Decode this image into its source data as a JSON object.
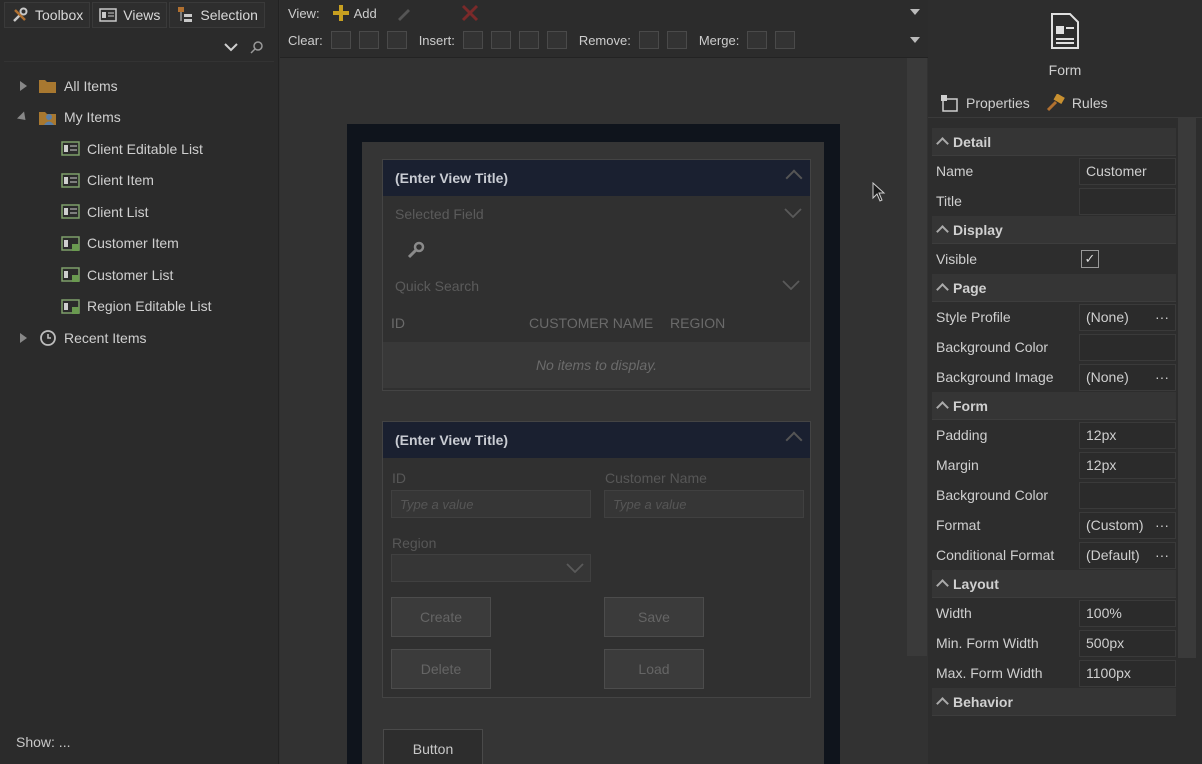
{
  "left_panel": {
    "tabs": [
      {
        "label": "Toolbox",
        "icon": "tools-icon"
      },
      {
        "label": "Views",
        "icon": "views-icon"
      },
      {
        "label": "Selection",
        "icon": "selection-icon"
      }
    ],
    "tree": [
      {
        "label": "All Items",
        "level": 0,
        "expander": "collapsed",
        "icon": "folder-icon"
      },
      {
        "label": "My Items",
        "level": 0,
        "expander": "expanded",
        "icon": "user-folder-icon"
      },
      {
        "label": "Client Editable List",
        "level": 1,
        "icon": "view-icon"
      },
      {
        "label": "Client Item",
        "level": 1,
        "icon": "view-icon"
      },
      {
        "label": "Client List",
        "level": 1,
        "icon": "view-icon"
      },
      {
        "label": "Customer Item",
        "level": 1,
        "icon": "view-icon"
      },
      {
        "label": "Customer List",
        "level": 1,
        "icon": "view-icon"
      },
      {
        "label": "Region Editable List",
        "level": 1,
        "icon": "view-icon"
      },
      {
        "label": "Recent Items",
        "level": 0,
        "expander": "collapsed",
        "icon": "history-icon"
      }
    ],
    "show_label": "Show: ..."
  },
  "toolbar": {
    "view_label": "View:",
    "add_label": "Add",
    "clear_label": "Clear:",
    "insert_label": "Insert:",
    "remove_label": "Remove:",
    "merge_label": "Merge:"
  },
  "canvas": {
    "view1": {
      "title": "(Enter View Title)",
      "selected_field_placeholder": "Selected Field",
      "quick_search_placeholder": "Quick Search",
      "columns": [
        "ID",
        "CUSTOMER NAME",
        "REGION"
      ],
      "empty_text": "No items to display."
    },
    "view2": {
      "title": "(Enter View Title)",
      "id_label": "ID",
      "id_placeholder": "Type a value",
      "name_label": "Customer Name",
      "name_placeholder": "Type a value",
      "region_label": "Region",
      "buttons": {
        "create": "Create",
        "save": "Save",
        "delete": "Delete",
        "load": "Load"
      }
    },
    "button_label": "Button"
  },
  "right_panel": {
    "header": "Form",
    "tabs": [
      {
        "label": "Properties",
        "icon": "properties-icon"
      },
      {
        "label": "Rules",
        "icon": "rules-icon"
      }
    ],
    "sections": [
      {
        "title": "Detail",
        "rows": [
          {
            "key": "Name",
            "value": "Customer"
          },
          {
            "key": "Title",
            "value": ""
          }
        ]
      },
      {
        "title": "Display",
        "rows": [
          {
            "key": "Visible",
            "checkbox": true
          }
        ]
      },
      {
        "title": "Page",
        "rows": [
          {
            "key": "Style Profile",
            "value": "(None)",
            "ellipsis": true
          },
          {
            "key": "Background Color",
            "value": ""
          },
          {
            "key": "Background Image",
            "value": "(None)",
            "ellipsis": true
          }
        ]
      },
      {
        "title": "Form",
        "rows": [
          {
            "key": "Padding",
            "value": "12px"
          },
          {
            "key": "Margin",
            "value": "12px"
          },
          {
            "key": "Background Color",
            "value": ""
          },
          {
            "key": "Format",
            "value": "(Custom)",
            "ellipsis": true
          },
          {
            "key": "Conditional Format",
            "value": "(Default)",
            "ellipsis": true
          }
        ]
      },
      {
        "title": "Layout",
        "rows": [
          {
            "key": "Width",
            "value": "100%"
          },
          {
            "key": "Min. Form Width",
            "value": "500px"
          },
          {
            "key": "Max. Form Width",
            "value": "1100px"
          }
        ]
      },
      {
        "title": "Behavior",
        "rows": []
      }
    ]
  }
}
